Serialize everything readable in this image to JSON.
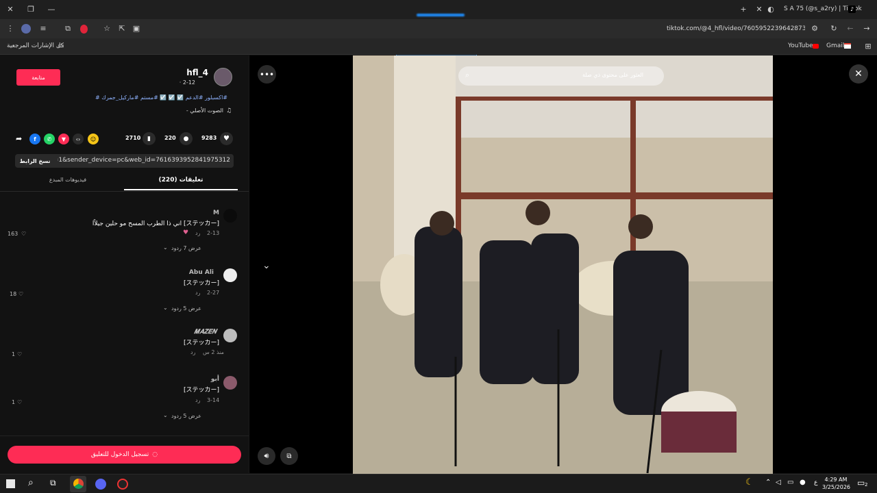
{
  "browser": {
    "tab_title": "S A 75 (@s_a2ry) | TikTok",
    "url": "tiktok.com/@4_hfl/video/7605952239642873108",
    "bookmarks": {
      "all_bookmarks": "كل الإشارات المرجعية",
      "youtube": "YouTube",
      "gmail": "Gmail"
    }
  },
  "post": {
    "username": "hfl_4",
    "date": "2-12 ·",
    "follow_label": "متابعة",
    "caption": "#اكسبلور #الدعم ☑️ ☑️ ☑️ #مستم #ماركيل_جمرك #",
    "sound": "الصوت الأصلي -",
    "likes": "9283",
    "comments": "220",
    "saves": "2710",
    "copy_link_label": "نسخ الرابط",
    "link": "p=1&sender_device=pc&web_id=7616393952841975312..."
  },
  "tabs": {
    "comments_label": "تعليقات (220)",
    "creator_videos_label": "فيديوهات المبدع"
  },
  "comments": [
    {
      "user": "M",
      "text": "[ステッカー] اني ذا الطرب المسح مو حلين جيلاًا",
      "date": "2-13",
      "reply_label": "رد",
      "likes": "163",
      "view_replies": "عرض 7 ردود"
    },
    {
      "user": "Abu Ali",
      "text": "[ステッカー]",
      "date": "2-27",
      "reply_label": "رد",
      "likes": "18",
      "view_replies": "عرض 5 ردود"
    },
    {
      "user": "𝑴𝑨𝒁𝑬𝑵",
      "text": "[ステッカー]",
      "date": "منذ 2 س",
      "reply_label": "رد",
      "likes": "1",
      "view_replies": ""
    },
    {
      "user": "أبو",
      "text": "[ステッカー]",
      "date": "3-14",
      "reply_label": "رد",
      "likes": "1",
      "view_replies": "عرض 5 ردود"
    }
  ],
  "login_label": "تسجيل الدخول للتعليق",
  "video": {
    "search_placeholder": "العثور على محتوى ذي صلة"
  },
  "taskbar": {
    "time": "4:29 AM",
    "date": "3/25/2026",
    "lang": "ع",
    "notif_count": "2"
  },
  "colors": {
    "accent": "#fe2c55",
    "panel_bg": "#121212"
  }
}
